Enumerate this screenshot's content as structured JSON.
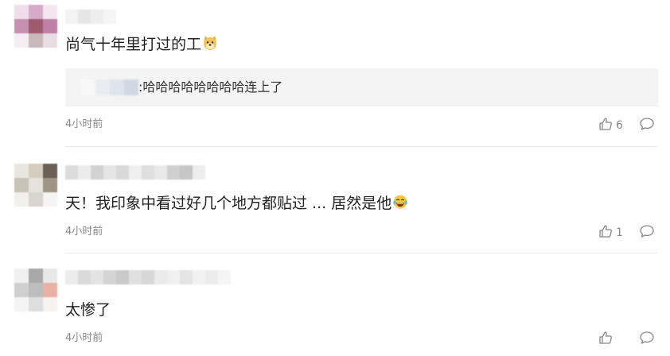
{
  "comments": [
    {
      "text": "尚气十年里打过的工",
      "emoji": "doge-emoji",
      "reply": {
        "text": ":哈哈哈哈哈哈哈哈连上了"
      },
      "time": "4小时前",
      "likes": "6"
    },
    {
      "text": "天！我印象中看过好几个地方都贴过 ... 居然是他",
      "emoji": "laughing-tears-emoji",
      "time": "4小时前",
      "likes": "1"
    },
    {
      "text": "太惨了",
      "time": "4小时前",
      "likes": ""
    }
  ],
  "colors": {
    "text": "#222222",
    "meta": "#888888",
    "reply_bg": "#f4f4f4",
    "divider": "#e8e8e8"
  },
  "icons": [
    "thumbs-up-icon",
    "comment-bubble-icon"
  ]
}
